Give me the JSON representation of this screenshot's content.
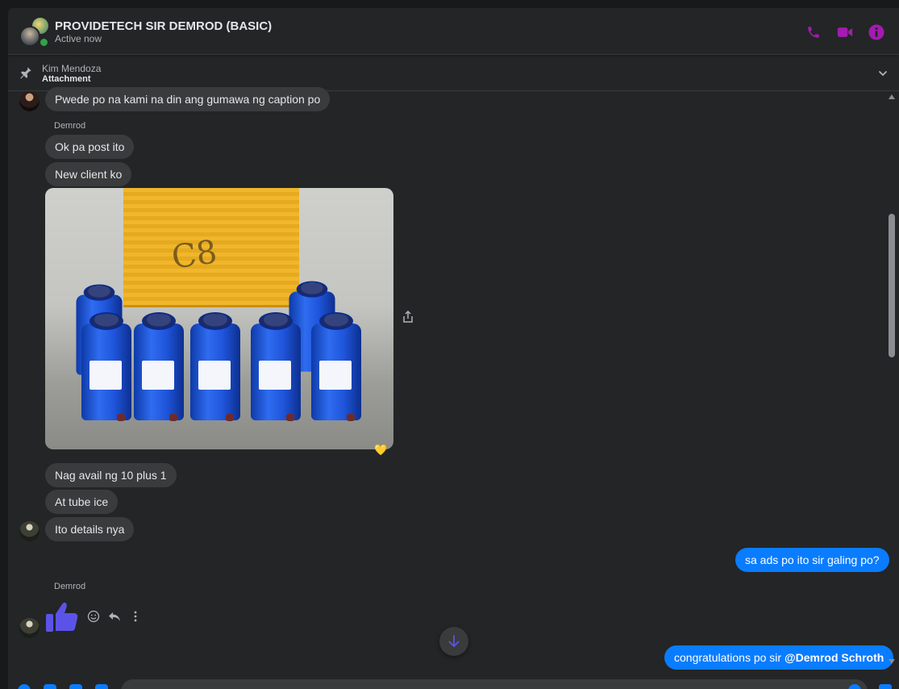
{
  "header": {
    "title": "PROVIDETECH SIR DEMROD (BASIC)",
    "status": "Active now",
    "accent": "#a21caf"
  },
  "pinned": {
    "name": "Kim Mendoza",
    "label": "Attachment"
  },
  "messages": [
    {
      "text": "Pwede po na kami na din ang gumawa ng caption po"
    },
    {
      "sender": "Demrod"
    },
    {
      "text": "Ok pa post ito"
    },
    {
      "text": "New client ko"
    },
    {
      "text": "Nag avail ng 10 plus 1"
    },
    {
      "text": "At tube ice"
    },
    {
      "text": "Ito details nya"
    },
    {
      "text": "sa ads po ito sir galing po?"
    },
    {
      "sender": "Demrod"
    },
    {
      "text_prefix": "congratulations po sir ",
      "mention": "@Demrod Schroth"
    }
  ],
  "photo": {
    "box_mark": "C8",
    "reaction": "💛"
  },
  "colors": {
    "background": "#242526",
    "bubble_other": "#3a3b3c",
    "bubble_me": "#0a7cff"
  }
}
